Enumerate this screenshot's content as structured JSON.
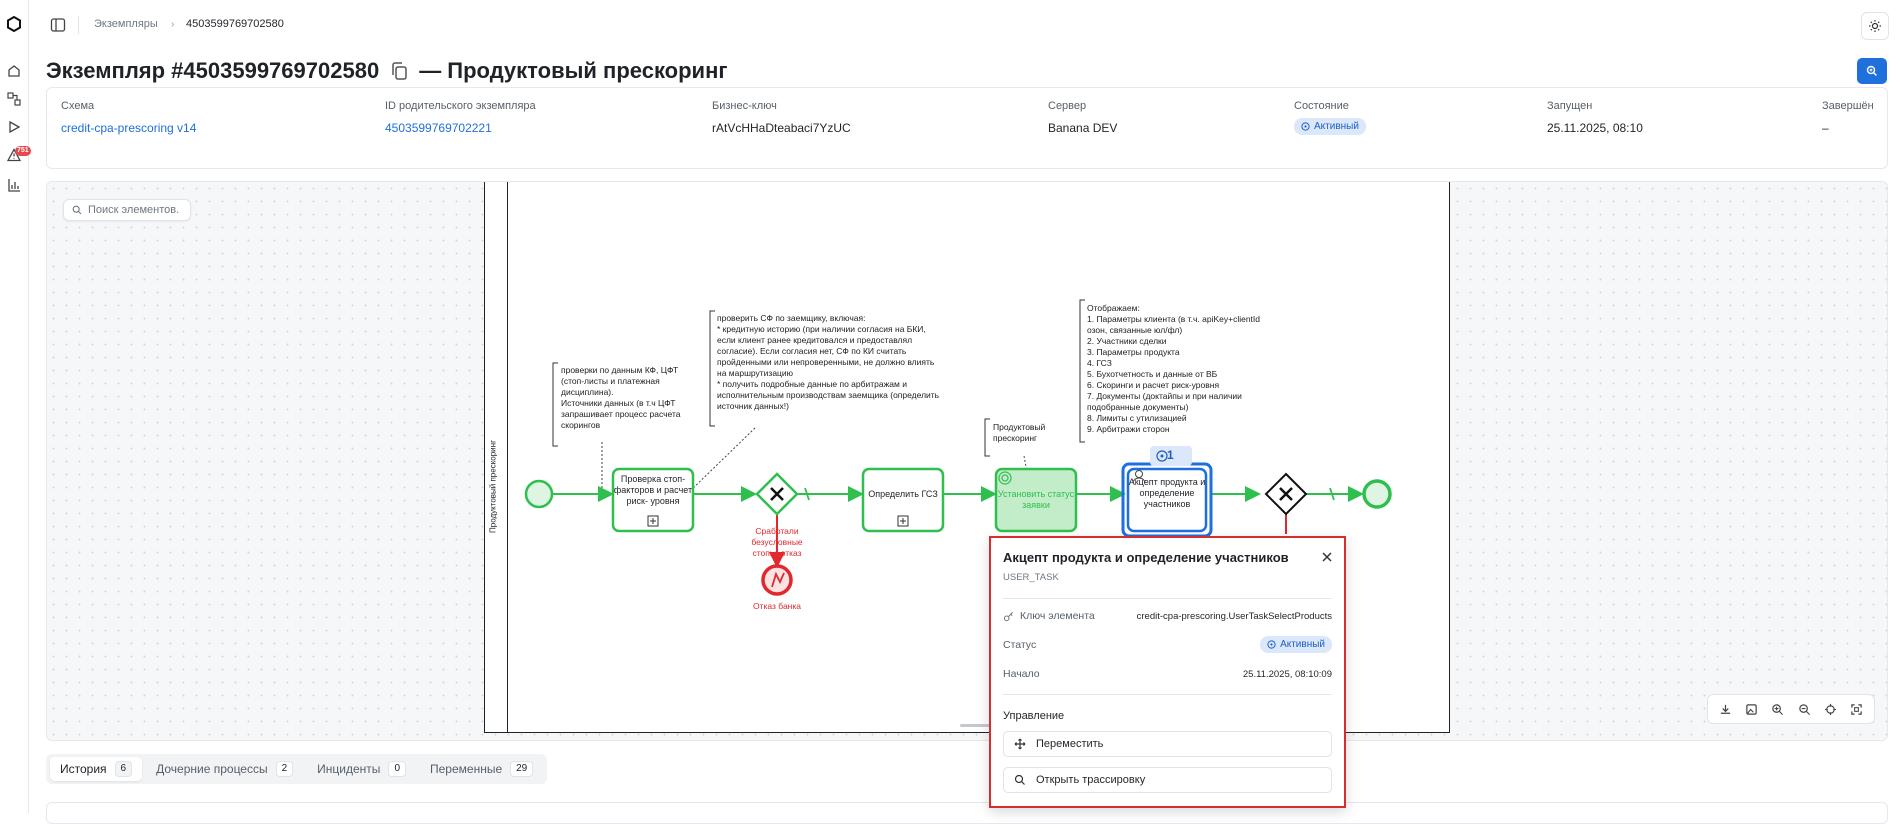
{
  "sidebar": {
    "badge": "751"
  },
  "breadcrumb": {
    "parent": "Экземпляры",
    "current": "4503599769702580"
  },
  "page": {
    "title_main": "Экземпляр #4503599769702580",
    "title_suffix": "— Продуктовый прескоринг"
  },
  "info": {
    "schema": {
      "label": "Схема",
      "value": "credit-cpa-prescoring v14"
    },
    "parent_id": {
      "label": "ID родительского экземпляра",
      "value": "4503599769702221"
    },
    "business_key": {
      "label": "Бизнес-ключ",
      "value": "rAtVcHHaDteabaci7YzUC"
    },
    "server": {
      "label": "Сервер",
      "value": "Banana DEV"
    },
    "state": {
      "label": "Состояние",
      "value": "Активный"
    },
    "started": {
      "label": "Запущен",
      "value": "25.11.2025, 08:10"
    },
    "finished": {
      "label": "Завершён",
      "value": "–"
    }
  },
  "canvas": {
    "search_placeholder": "Поиск элементов.",
    "lane_name": "Продуктовый прескоринг",
    "annotations": {
      "a1": "проверки по данным КФ, ЦФТ\n(стоп-листы и платежная\nдисциплина).\nИсточники данных (в т.ч ЦФТ\nзапрашивает процесс расчета\nскорингов",
      "a2": "проверить СФ по заемщику, включая:\n* кредитную историю (при наличии согласия на БКИ,\nесли клиент ранее кредитовался и предоставлял\nсогласие). Если согласия нет, СФ по КИ считать\nпройденными или непроверенными, не должно влиять\nна маршрутизацию\n* получить подробные данные по арбитражам и\nисполнительным производствам заемщика (определить\nисточник данных!)",
      "a3": "Продуктовый\nпрескоринг",
      "a4": "Отображаем:\n1. Параметры клиента (в т.ч. apiKey+clientId\nозон, связанные юл/фл)\n2. Участники сделки\n3. Параметры продукта\n4. ГСЗ\n5. Бухотчетность и данные от ВБ\n6. Скоринги и расчет риск-уровня\n7. Документы (доктайпы и при наличии\nподобранные документы)\n8. Лимиты с утилизацией\n9. Арбитражи сторон"
    },
    "tasks": {
      "t1": "Проверка\nстоп-факторов\nи расчет риск-\nуровня",
      "t2": "Определить\nГСЗ",
      "t3": "Установить\nстатус заявки",
      "t4": "Акцепт\nпродукта и\nопределение\nучастников"
    },
    "gateway_label": "Сработали\nбезусловные\nстопы, отказ",
    "end_error_label": "Отказ банка",
    "token_count": "1"
  },
  "popup": {
    "title": "Акцепт продукта и определение участников",
    "type": "USER_TASK",
    "key_label": "Ключ элемента",
    "key_value": "credit-cpa-prescoring.UserTaskSelectProducts",
    "status_label": "Статус",
    "status_value": "Активный",
    "start_label": "Начало",
    "start_value": "25.11.2025, 08:10:09",
    "manage_label": "Управление",
    "move_label": "Переместить",
    "trace_label": "Открыть трассировку"
  },
  "tabs": [
    {
      "label": "История",
      "count": "6"
    },
    {
      "label": "Дочерние процессы",
      "count": "2"
    },
    {
      "label": "Инциденты",
      "count": "0"
    },
    {
      "label": "Переменные",
      "count": "29"
    }
  ],
  "colors": {
    "accent": "#1f6fdc",
    "flow_green": "#2fbf4f",
    "error_red": "#e0282e",
    "popup_border": "#d32f2f"
  }
}
